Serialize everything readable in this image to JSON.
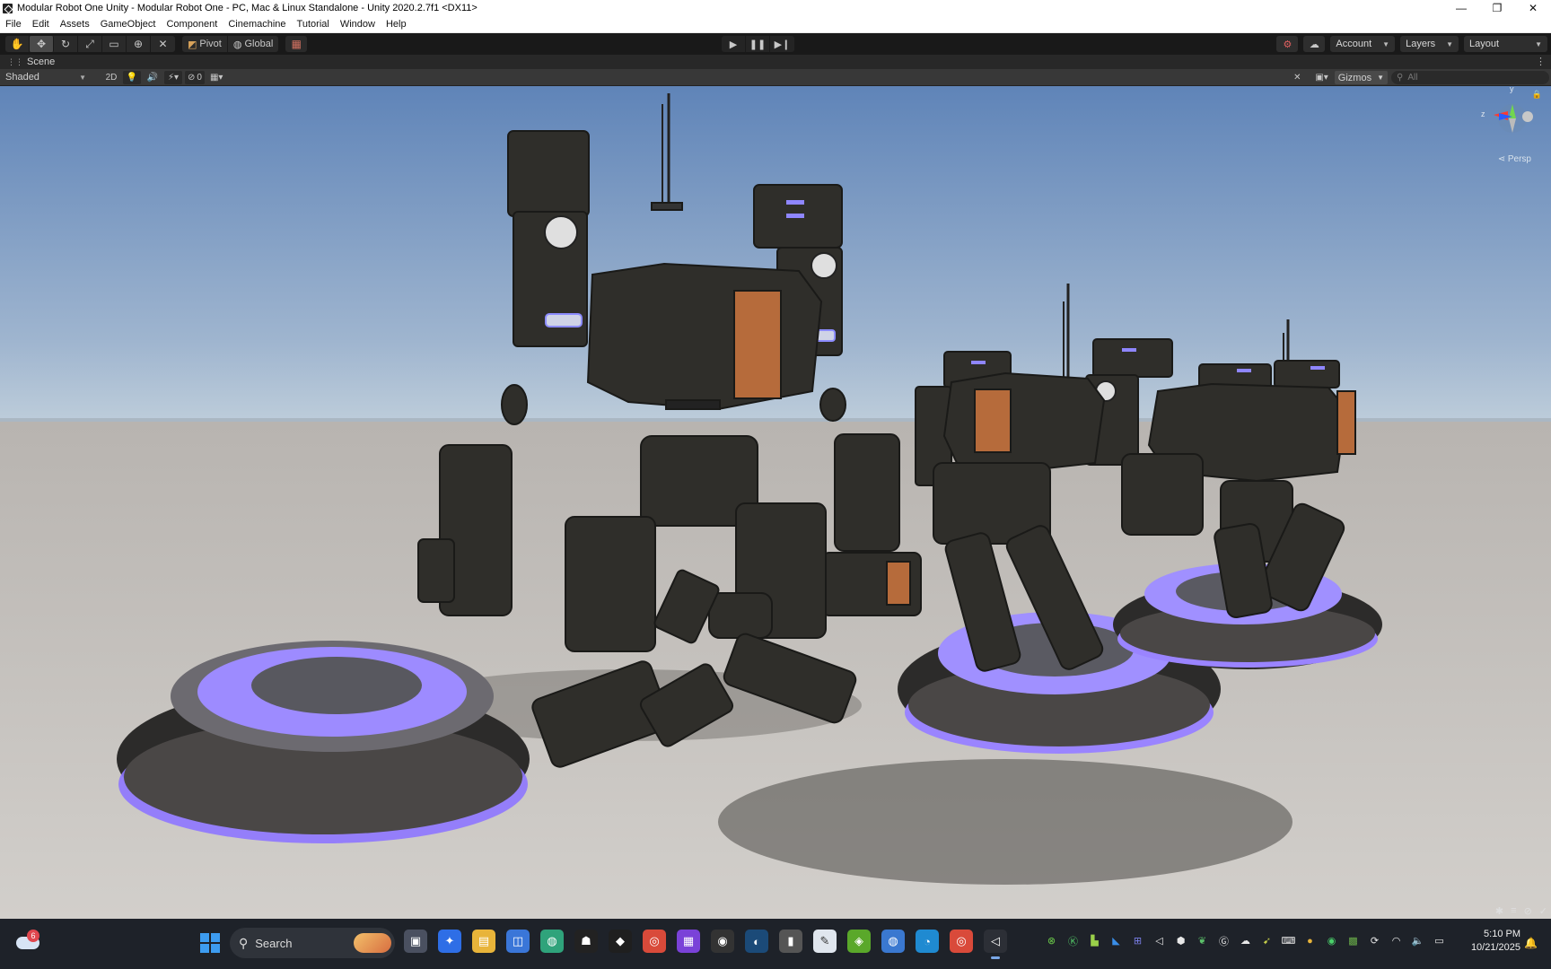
{
  "window": {
    "title": "Modular Robot One Unity - Modular Robot One - PC, Mac & Linux Standalone - Unity 2020.2.7f1 <DX11>",
    "controls": [
      "—",
      "❐",
      "✕"
    ]
  },
  "menu": [
    "File",
    "Edit",
    "Assets",
    "GameObject",
    "Component",
    "Cinemachine",
    "Tutorial",
    "Window",
    "Help"
  ],
  "toolbar": {
    "tools": [
      "hand-tool",
      "move-tool",
      "rotate-tool",
      "scale-tool",
      "rect-tool",
      "transform-tool",
      "custom-tool"
    ],
    "active_tool": "move-tool",
    "pivot_label": "Pivot",
    "global_label": "Global",
    "account_label": "Account",
    "layers_label": "Layers",
    "layout_label": "Layout"
  },
  "scene": {
    "tab_label": "Scene",
    "shading_mode": "Shaded",
    "two_d_label": "2D",
    "hidden_count": "0",
    "gizmos_label": "Gizmos",
    "search_placeholder": "All",
    "projection_label": "Persp"
  },
  "colors": {
    "glow": "#7a5cff",
    "sky_top": "#5f84b8",
    "sky_horizon": "#b9c9d8",
    "ground": "#c9c6c2"
  },
  "taskbar": {
    "weather_badge": "6",
    "search_label": "Search",
    "time": "5:10 PM",
    "date": "10/21/2025"
  }
}
